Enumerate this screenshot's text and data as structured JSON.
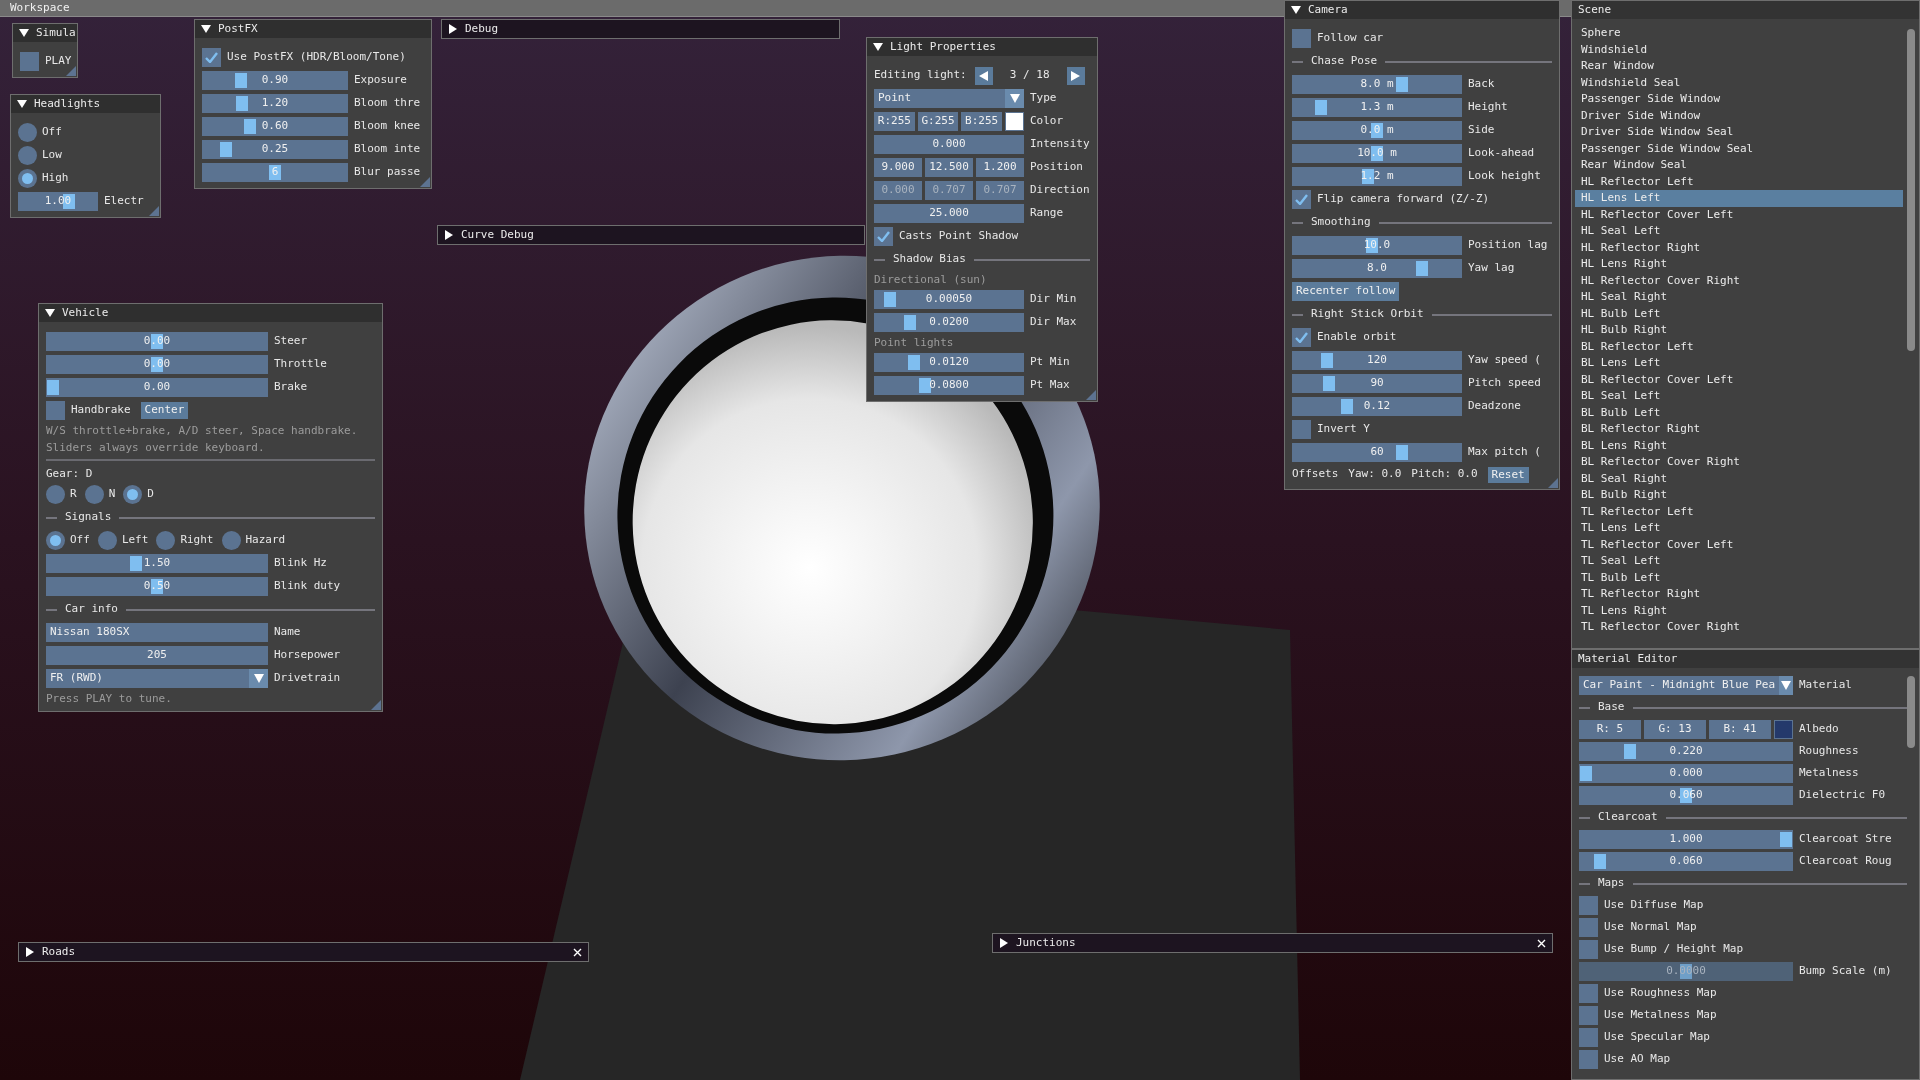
{
  "workspace": {
    "title": "Workspace"
  },
  "windows": [
    {
      "title": "Simula",
      "expanded": true,
      "closable": false,
      "items": [
        {
          "kind": "checkbox",
          "text": "PLAY",
          "checked": false
        }
      ]
    },
    {
      "title": "PostFX",
      "expanded": true,
      "closable": false,
      "items": [
        {
          "kind": "checkbox",
          "text": "Use PostFX (HDR/Bloom/Tone)",
          "checked": true
        },
        {
          "kind": "slider",
          "value": "0.90",
          "label": "Exposure",
          "level": 0.24
        },
        {
          "kind": "slider",
          "value": "1.20",
          "label": "Bloom thre",
          "level": 0.25
        },
        {
          "kind": "slider",
          "value": "0.60",
          "label": "Bloom knee",
          "level": 0.31
        },
        {
          "kind": "slider",
          "value": "0.25",
          "label": "Bloom inte",
          "level": 0.13
        },
        {
          "kind": "slider",
          "value": "6",
          "label": "Blur passe",
          "level": 0.5
        }
      ]
    },
    {
      "title": "Debug",
      "expanded": false,
      "closable": false
    },
    {
      "title": "Light Properties",
      "expanded": true,
      "closable": false,
      "items": [
        {
          "kind": "stepper",
          "text": "Editing light:",
          "counter": "3 / 18"
        },
        {
          "kind": "combo",
          "value": "Point",
          "label": "Type"
        },
        {
          "kind": "color",
          "fields": [
            "R:255",
            "G:255",
            "B:255"
          ],
          "color": "#ffffff",
          "label": "Color"
        },
        {
          "kind": "input",
          "value": "0.000",
          "label": "Intensity"
        },
        {
          "kind": "multi",
          "fields": [
            "9.000",
            "12.500",
            "1.200"
          ],
          "label": "Position",
          "disabled": false
        },
        {
          "kind": "multi",
          "fields": [
            "0.000",
            "0.707",
            "0.707"
          ],
          "label": "Direction",
          "disabled": true
        },
        {
          "kind": "input",
          "value": "25.000",
          "label": "Range"
        },
        {
          "kind": "checkbox",
          "text": "Casts Point Shadow",
          "checked": true
        },
        {
          "kind": "separator",
          "text": "Shadow Bias"
        },
        {
          "kind": "note",
          "text": "Directional (sun)"
        },
        {
          "kind": "slider",
          "value": "0.00050",
          "label": "Dir Min",
          "level": 0.065
        },
        {
          "kind": "slider",
          "value": "0.0200",
          "label": "Dir Max",
          "level": 0.21
        },
        {
          "kind": "note",
          "text": "Point lights"
        },
        {
          "kind": "slider",
          "value": "0.0120",
          "label": "Pt Min",
          "level": 0.24
        },
        {
          "kind": "slider",
          "value": "0.0800",
          "label": "Pt Max",
          "level": 0.32
        }
      ]
    },
    {
      "title": "Camera",
      "expanded": true,
      "closable": false,
      "items": [
        {
          "kind": "checkbox",
          "text": "Follow car",
          "checked": false
        },
        {
          "kind": "separator",
          "text": "Chase Pose"
        },
        {
          "kind": "slider",
          "value": "8.0 m",
          "label": "Back",
          "level": 0.66
        },
        {
          "kind": "slider",
          "value": "1.3 m",
          "label": "Height",
          "level": 0.14
        },
        {
          "kind": "slider",
          "value": "0.0 m",
          "label": "Side",
          "level": 0.5
        },
        {
          "kind": "slider",
          "value": "10.0 m",
          "label": "Look-ahead",
          "level": 0.5
        },
        {
          "kind": "slider",
          "value": "1.2 m",
          "label": "Look height",
          "level": 0.44
        },
        {
          "kind": "checkbox",
          "text": "Flip camera forward (Z/-Z)",
          "checked": true
        },
        {
          "kind": "separator",
          "text": "Smoothing"
        },
        {
          "kind": "slider",
          "value": "10.0",
          "label": "Position lag",
          "level": 0.47
        },
        {
          "kind": "slider",
          "value": "8.0",
          "label": "Yaw lag",
          "level": 0.79
        },
        {
          "kind": "button",
          "text": "Recenter follow"
        },
        {
          "kind": "separator",
          "text": "Right Stick Orbit"
        },
        {
          "kind": "checkbox",
          "text": "Enable orbit",
          "checked": true
        },
        {
          "kind": "slider",
          "value": "120",
          "label": "Yaw speed (",
          "level": 0.18
        },
        {
          "kind": "slider",
          "value": "90",
          "label": "Pitch speed",
          "level": 0.19
        },
        {
          "kind": "slider",
          "value": "0.12",
          "label": "Deadzone",
          "level": 0.31
        },
        {
          "kind": "checkbox",
          "text": "Invert Y",
          "checked": false
        },
        {
          "kind": "slider",
          "value": "60",
          "label": "Max pitch (",
          "level": 0.66
        },
        {
          "kind": "status",
          "texts": [
            "Offsets",
            "Yaw: 0.0",
            "Pitch: 0.0"
          ],
          "button": "Reset"
        }
      ]
    },
    {
      "title": "Headlights",
      "expanded": true,
      "closable": false,
      "items": [
        {
          "kind": "radio_column",
          "options": [
            {
              "text": "Off",
              "selected": false
            },
            {
              "text": "Low",
              "selected": false
            },
            {
              "text": "High",
              "selected": true
            }
          ]
        },
        {
          "kind": "slider",
          "value": "1.00",
          "label": "Electr",
          "level": 0.66
        }
      ]
    },
    {
      "title": "Curve Debug",
      "expanded": false,
      "closable": false
    },
    {
      "title": "Vehicle",
      "expanded": true,
      "closable": false,
      "items": [
        {
          "kind": "slider",
          "value": "0.00",
          "label": "Steer",
          "level": 0.5
        },
        {
          "kind": "slider",
          "value": "0.00",
          "label": "Throttle",
          "level": 0.5
        },
        {
          "kind": "slider",
          "value": "0.00",
          "label": "Brake",
          "level": 0
        },
        {
          "kind": "checkbox",
          "text": "Handbrake",
          "checked": false,
          "button": "Center"
        },
        {
          "kind": "note",
          "text": "W/S throttle+brake, A/D steer, Space handbrake."
        },
        {
          "kind": "note",
          "text": "Sliders always override keyboard."
        },
        {
          "kind": "rule"
        },
        {
          "kind": "text",
          "text": "Gear: D"
        },
        {
          "kind": "radio_row",
          "options": [
            {
              "text": "R",
              "selected": false
            },
            {
              "text": "N",
              "selected": false
            },
            {
              "text": "D",
              "selected": true
            }
          ]
        },
        {
          "kind": "separator",
          "text": "Signals"
        },
        {
          "kind": "radio_row",
          "options": [
            {
              "text": "Off",
              "selected": true
            },
            {
              "text": "Left",
              "selected": false
            },
            {
              "text": "Right",
              "selected": false
            },
            {
              "text": "Hazard",
              "selected": false
            }
          ]
        },
        {
          "kind": "slider",
          "value": "1.50",
          "label": "Blink Hz",
          "level": 0.4
        },
        {
          "kind": "slider",
          "value": "0.50",
          "label": "Blink duty",
          "level": 0.5
        },
        {
          "kind": "separator",
          "text": "Car info"
        },
        {
          "kind": "text_input",
          "value": "Nissan 180SX",
          "label": "Name"
        },
        {
          "kind": "input",
          "value": "205",
          "label": "Horsepower"
        },
        {
          "kind": "combo",
          "value": "FR (RWD)",
          "label": "Drivetrain"
        },
        {
          "kind": "note",
          "text": "Press PLAY to tune."
        }
      ]
    },
    {
      "title": "Junctions",
      "expanded": false,
      "closable": true
    },
    {
      "title": "Roads",
      "expanded": false,
      "closable": true
    }
  ],
  "scene": {
    "title": "Scene",
    "items": [
      {
        "label": "Sphere",
        "selected": false
      },
      {
        "label": "Windshield",
        "selected": false
      },
      {
        "label": "Rear Window",
        "selected": false
      },
      {
        "label": "Windshield Seal",
        "selected": false
      },
      {
        "label": "Passenger Side Window",
        "selected": false
      },
      {
        "label": "Driver Side Window",
        "selected": false
      },
      {
        "label": "Driver Side Window Seal",
        "selected": false
      },
      {
        "label": "Passenger Side Window Seal",
        "selected": false
      },
      {
        "label": "Rear Window Seal",
        "selected": false
      },
      {
        "label": "HL Reflector Left",
        "selected": false
      },
      {
        "label": "HL Lens Left",
        "selected": true
      },
      {
        "label": "HL Reflector Cover Left",
        "selected": false
      },
      {
        "label": "HL Seal Left",
        "selected": false
      },
      {
        "label": "HL Reflector Right",
        "selected": false
      },
      {
        "label": "HL Lens Right",
        "selected": false
      },
      {
        "label": "HL Reflector Cover Right",
        "selected": false
      },
      {
        "label": "HL Seal Right",
        "selected": false
      },
      {
        "label": "HL Bulb Left",
        "selected": false
      },
      {
        "label": "HL Bulb Right",
        "selected": false
      },
      {
        "label": "BL Reflector Left",
        "selected": false
      },
      {
        "label": "BL Lens Left",
        "selected": false
      },
      {
        "label": "BL Reflector Cover Left",
        "selected": false
      },
      {
        "label": "BL Seal Left",
        "selected": false
      },
      {
        "label": "BL Bulb Left",
        "selected": false
      },
      {
        "label": "BL Reflector Right",
        "selected": false
      },
      {
        "label": "BL Lens Right",
        "selected": false
      },
      {
        "label": "BL Reflector Cover Right",
        "selected": false
      },
      {
        "label": "BL Seal Right",
        "selected": false
      },
      {
        "label": "BL Bulb Right",
        "selected": false
      },
      {
        "label": "TL Reflector Left",
        "selected": false
      },
      {
        "label": "TL Lens Left",
        "selected": false
      },
      {
        "label": "TL Reflector Cover Left",
        "selected": false
      },
      {
        "label": "TL Seal Left",
        "selected": false
      },
      {
        "label": "TL Bulb Left",
        "selected": false
      },
      {
        "label": "TL Reflector Right",
        "selected": false
      },
      {
        "label": "TL Lens Right",
        "selected": false
      },
      {
        "label": "TL Reflector Cover Right",
        "selected": false
      }
    ]
  },
  "material_editor": {
    "title": "Material Editor",
    "items": [
      {
        "kind": "combo",
        "value": "Car Paint - Midnight Blue Pea",
        "label": "Material"
      },
      {
        "kind": "separator",
        "text": "Base"
      },
      {
        "kind": "color",
        "fields": [
          "R: 5",
          "G: 13",
          "B: 41"
        ],
        "color": "#24396b",
        "label": "Albedo"
      },
      {
        "kind": "slider",
        "value": "0.220",
        "label": "Roughness",
        "level": 0.22
      },
      {
        "kind": "slider",
        "value": "0.000",
        "label": "Metalness",
        "level": 0
      },
      {
        "kind": "slider",
        "value": "0.060",
        "label": "Dielectric F0",
        "level": 0.5
      },
      {
        "kind": "separator",
        "text": "Clearcoat"
      },
      {
        "kind": "slider",
        "value": "1.000",
        "label": "Clearcoat Stre",
        "level": 1
      },
      {
        "kind": "slider",
        "value": "0.060",
        "label": "Clearcoat Roug",
        "level": 0.07
      },
      {
        "kind": "separator",
        "text": "Maps"
      },
      {
        "kind": "checkbox",
        "text": "Use Diffuse Map",
        "checked": false
      },
      {
        "kind": "checkbox",
        "text": "Use Normal Map",
        "checked": false
      },
      {
        "kind": "checkbox",
        "text": "Use Bump / Height Map",
        "checked": false
      },
      {
        "kind": "slider",
        "value": "0.0000",
        "label": "Bump Scale (m)",
        "level": 0.5,
        "disabled": true
      },
      {
        "kind": "checkbox",
        "text": "Use Roughness Map",
        "checked": false
      },
      {
        "kind": "checkbox",
        "text": "Use Metalness Map",
        "checked": false
      },
      {
        "kind": "checkbox",
        "text": "Use Specular Map",
        "checked": false
      },
      {
        "kind": "checkbox",
        "text": "Use AO Map",
        "checked": false
      }
    ]
  }
}
